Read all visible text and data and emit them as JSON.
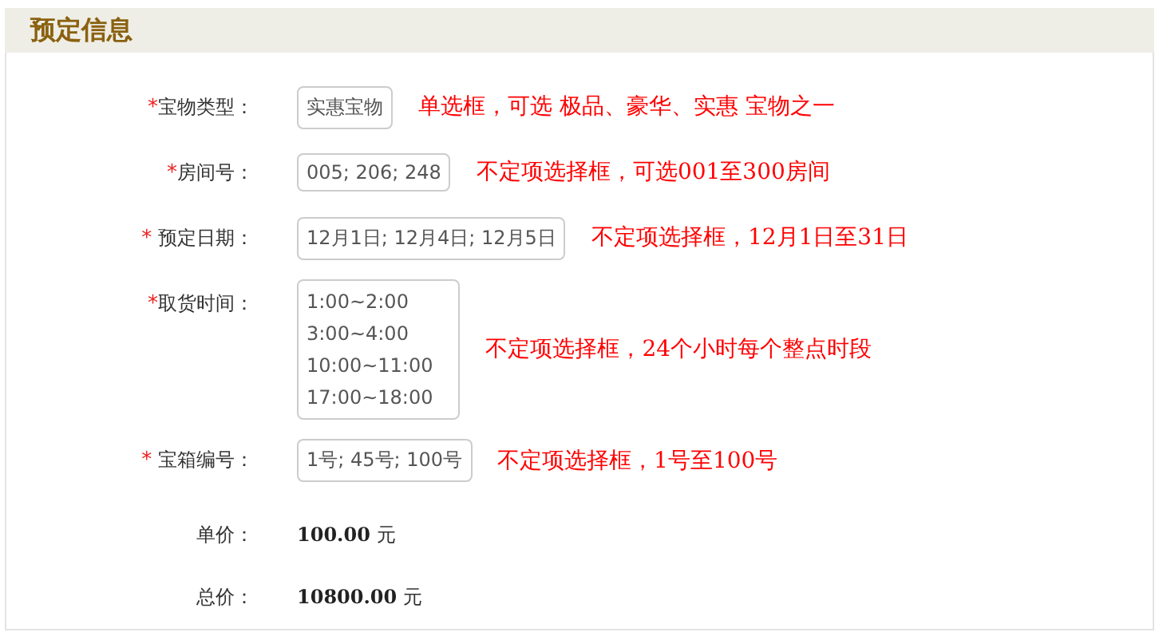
{
  "section": {
    "title": "预定信息"
  },
  "rows": [
    {
      "kind": "field",
      "mark": "*",
      "label": "宝物类型：",
      "value": "实惠宝物",
      "note": "单选框，可选 极品、豪华、实惠 宝物之一"
    },
    {
      "kind": "field",
      "mark": "*",
      "label": "房间号：",
      "value": "005; 206; 248",
      "note": "不定项选择框，可选001至300房间"
    },
    {
      "kind": "field",
      "mark": "*",
      "label": " 预定日期：",
      "value": "12月1日; 12月4日; 12月5日",
      "note": "不定项选择框，12月1日至31日"
    },
    {
      "kind": "list",
      "mark": "*",
      "label": "取货时间：",
      "items": [
        "1:00~2:00",
        "3:00~4:00",
        "10:00~11:00",
        "17:00~18:00"
      ],
      "note": "不定项选择框，24个小时每个整点时段"
    },
    {
      "kind": "field",
      "mark": "*",
      "label": " 宝箱编号：",
      "value": "1号; 45号; 100号",
      "note": "不定项选择框，1号至100号"
    },
    {
      "kind": "price",
      "label": "单价：",
      "value": "100.00",
      "unit": "元"
    },
    {
      "kind": "price",
      "label": "总价：",
      "value": "10800.00",
      "unit": "元"
    }
  ]
}
